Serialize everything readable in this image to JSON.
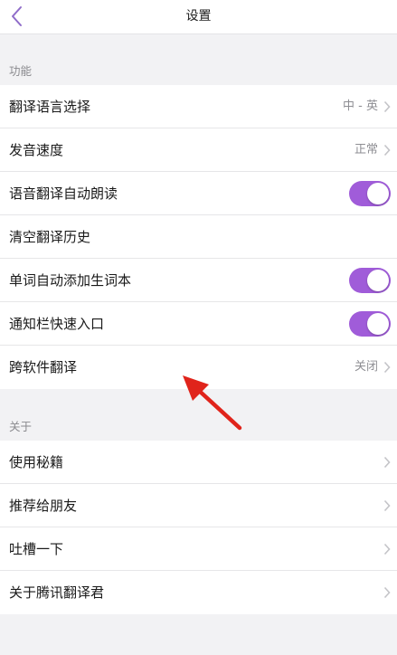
{
  "navbar": {
    "title": "设置",
    "back_icon": "chevron-left-icon"
  },
  "sections": {
    "features": {
      "header": "功能",
      "rows": [
        {
          "label": "翻译语言选择",
          "value": "中 - 英"
        },
        {
          "label": "发音速度",
          "value": "正常"
        },
        {
          "label": "语音翻译自动朗读",
          "toggle": true
        },
        {
          "label": "清空翻译历史"
        },
        {
          "label": "单词自动添加生词本",
          "toggle": true
        },
        {
          "label": "通知栏快速入口",
          "toggle": true
        },
        {
          "label": "跨软件翻译",
          "value": "关闭"
        }
      ]
    },
    "about": {
      "header": "关于",
      "rows": [
        {
          "label": "使用秘籍"
        },
        {
          "label": "推荐给朋友"
        },
        {
          "label": "吐槽一下"
        },
        {
          "label": "关于腾讯翻译君"
        }
      ]
    }
  },
  "colors": {
    "accent": "#a05cd9",
    "background": "#f2f2f4",
    "annotation_arrow": "#e0241b"
  }
}
